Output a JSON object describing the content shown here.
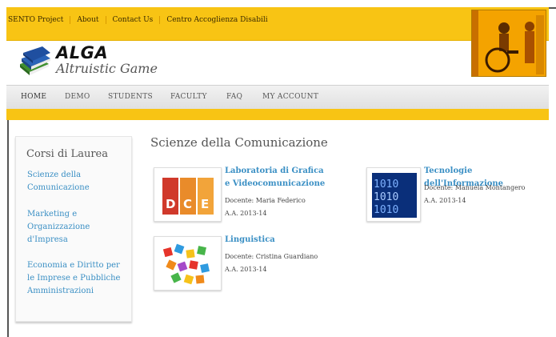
{
  "topnav": {
    "links": [
      "SENTO Project",
      "About",
      "Contact Us",
      "Centro Accoglienza Disabili"
    ]
  },
  "logo": {
    "title": "ALGA",
    "subtitle": "Altruistic Game"
  },
  "mainnav": {
    "items": [
      "HOME",
      "DEMO",
      "STUDENTS",
      "FACULTY",
      "FAQ",
      "MY ACCOUNT"
    ]
  },
  "sidebar": {
    "heading": "Corsi di Laurea",
    "links": [
      "Scienze della Comunicazione",
      "Marketing e Organizzazione d'Impresa",
      "Economia e Diritto per le Imprese e Pubbliche Amministrazioni"
    ]
  },
  "content": {
    "title": "Scienze della Comunicazione",
    "courses": [
      {
        "title": "Laboratoria di Grafica e Videocomunicazione",
        "teacher": "Docente: Maria Federico",
        "year": "A.A. 2013-14",
        "thumb_letters": [
          "D",
          "C",
          "E"
        ]
      },
      {
        "title": "Tecnologie dell'Informazione",
        "teacher": "Docente: Manuela Montangero",
        "year": "A.A. 2013-14",
        "thumb_digits": "1010"
      },
      {
        "title": "Linguistica",
        "teacher": "Docente: Cristina Guardiano",
        "year": "A.A. 2013-14"
      }
    ]
  },
  "colors": {
    "accent_yellow": "#f8c414",
    "link_blue": "#3a8fc4"
  }
}
